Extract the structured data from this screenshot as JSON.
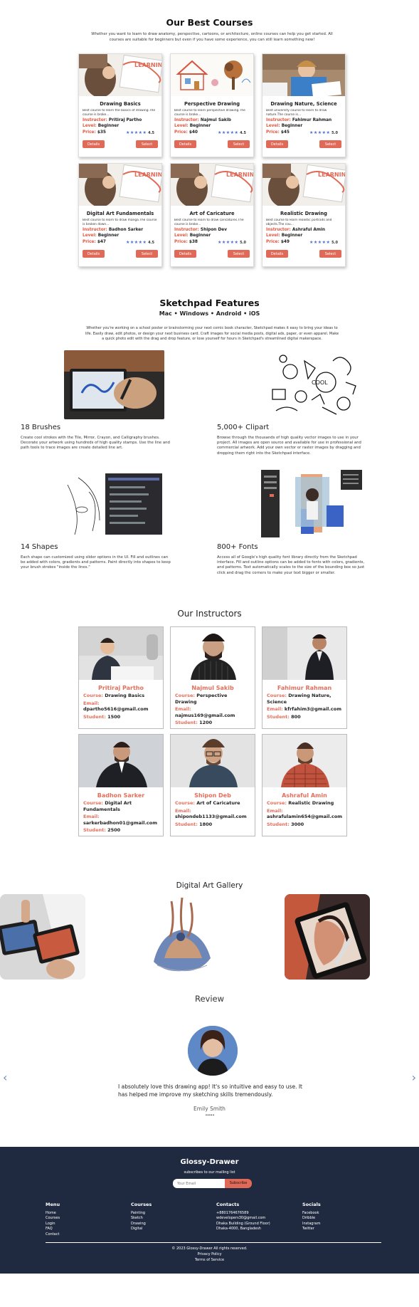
{
  "courses_section": {
    "title": "Our Best Courses",
    "intro": "Whether you want to learn to draw anatomy, perspective, cartoons, or architecture, online courses can help you get started. All courses are suitable for beginners but even if you have some experience, you can still learn something new!"
  },
  "labels": {
    "instructor": "Instructor:",
    "level": "Level:",
    "price": "Price:",
    "details": "Details",
    "select": "Select",
    "course": "Course:",
    "email": "Email:",
    "student": "Student:"
  },
  "courses": [
    {
      "title": "Drawing Basics",
      "desc": "Best course to learn the basics of drawing.The course is broke...",
      "instructor": "Pritiraj Partho",
      "level": "Beginner",
      "price": "$35",
      "stars": "★★★★★",
      "rating": "4.5"
    },
    {
      "title": "Perspective Drawing",
      "desc": "Best course to learn perspective drawing.The course is broke...",
      "instructor": "Najmul Sakib",
      "level": "Beginner",
      "price": "$40",
      "stars": "★★★★★",
      "rating": "4.5"
    },
    {
      "title": "Drawing Nature, Science",
      "desc": "Best university course to learn to draw nature.The course is...",
      "instructor": "Fahimur Rahman",
      "level": "Beginner",
      "price": "$45",
      "stars": "★★★★★",
      "rating": "5.0"
    },
    {
      "title": "Digital Art Fundamentals",
      "desc": "Best course to learn to draw manga.The course is broken down...",
      "instructor": "Badhon Sarker",
      "level": "Beginner",
      "price": "$47",
      "stars": "★★★★★",
      "rating": "4.5"
    },
    {
      "title": "Art of Caricature",
      "desc": "Best course to learn to draw caricatures.The course is broke...",
      "instructor": "Shipon Dev",
      "level": "Beginner",
      "price": "$38",
      "stars": "★★★★★",
      "rating": "5.0"
    },
    {
      "title": "Realistic Drawing",
      "desc": "Best course to learn realistic portraits and objects.The cou...",
      "instructor": "Ashraful Amin",
      "level": "Beginner",
      "price": "$49",
      "stars": "★★★★★",
      "rating": "5.0"
    }
  ],
  "features_section": {
    "title": "Sketchpad Features",
    "platforms": "Mac • Windows • Android • iOS",
    "intro": "Whether you're working on a school poster or brainstorming your next comic book character, Sketchpad makes it easy to bring your ideas to life. Easily draw, edit photos, or design your next business card. Craft images for social media posts, digital ads, paper, or even apparel. Make a quick photo edit with the drag and drop feature, or lose yourself for hours in Sketchpad's streamlined digital makerspace.",
    "items": [
      {
        "title": "18 Brushes",
        "desc": "Create cool strokes with the Tile, Mirror, Crayon, and Calligraphy brushes. Decorate your artwork using hundreds of high quality stamps. Use the line and path tools to trace images are create detailed line art."
      },
      {
        "title": "5,000+ Clipart",
        "desc": "Browse through the thousands of high quality vector images to use in your project. All images are open source and available for use in professional and commercial artwork. Add your own vector or raster images by dragging and dropping them right into the Sketchpad interface."
      },
      {
        "title": "14 Shapes",
        "desc": "Each shape can customized using slider options in the UI. Fill and outlines can be added with colors, gradients and patterns. Paint directly into shapes to keep your brush strokes \"inside the lines.\""
      },
      {
        "title": "800+ Fonts",
        "desc": "Access all of Google's high quality font library directly from the Sketchpad interface. Fill and outline options can be added to fonts with colors, gradients, and patterns. Text automatically scales to the size of the bounding box so just click and drag the corners to make your text bigger or smaller."
      }
    ]
  },
  "instructors_section": {
    "title": "Our Instructors"
  },
  "instructors": [
    {
      "name": "Pritiraj Partho",
      "course": "Drawing Basics",
      "email": "dpartho5616@gmail.com",
      "students": "1500"
    },
    {
      "name": "Najmul Sakib",
      "course": "Perspective Drawing",
      "email": "najmus169@gmail.com",
      "students": "1200"
    },
    {
      "name": "Fahimur Rahman",
      "course": "Drawing Nature, Science",
      "email": "kfrfahim3@gmail.com",
      "students": "800"
    },
    {
      "name": "Badhon Sarker",
      "course": "Digital Art Fundamentals",
      "email": "sarkerbadhon01@gmail.com",
      "students": "2500"
    },
    {
      "name": "Shipon Deb",
      "course": "Art of Caricature",
      "email": "shipondeb1133@gmail.com",
      "students": "1800"
    },
    {
      "name": "Ashraful Amin",
      "course": "Realistic Drawing",
      "email": "ashrafulamin654@gmail.com",
      "students": "3000"
    }
  ],
  "gallery": {
    "title": "Digital Art Gallery"
  },
  "review": {
    "title": "Review",
    "text": "I absolutely love this drawing app! It's so intuitive and easy to use. It has helped me improve my sketching skills tremendously.",
    "author": "Emily Smith",
    "dots": "• • • • •",
    "prev_arrow": "‹",
    "next_arrow": "›"
  },
  "footer": {
    "brand": "Glossy-Drawer",
    "subscribe_text": "subscribes to our mailing list",
    "email_placeholder": "Your Email",
    "subscribe_button": "Subscribe",
    "columns": [
      {
        "heading": "Menu",
        "items": [
          "Home",
          "Courses",
          "Login",
          "FAQ",
          "Contact"
        ]
      },
      {
        "heading": "Courses",
        "items": [
          "Painting",
          "Sketch",
          "Drawing",
          "Digital"
        ]
      },
      {
        "heading": "Contacts",
        "items": [
          "+8801764676589",
          "wdevelopers30@gmail.com",
          "Dhaka Building (Ground Floor)",
          "Dhaka-4000, Bangladesh"
        ]
      },
      {
        "heading": "Socials",
        "items": [
          "Facebook",
          "Dribble",
          "Instagram",
          "Twitter"
        ]
      }
    ],
    "copyright": "© 2023 Glossy-Drawer All rights reserved.",
    "privacy": "Privacy Policy",
    "terms": "Terms of Service"
  },
  "colors": {
    "accent": "#e2563f",
    "button": "#e06a57",
    "stars": "#4c6fd6",
    "footer_bg": "#1f2a40"
  }
}
